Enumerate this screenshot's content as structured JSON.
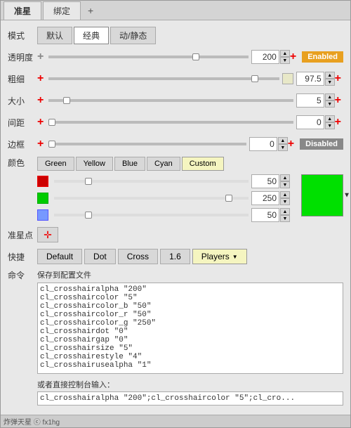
{
  "tabs": [
    {
      "label": "准星",
      "active": true
    },
    {
      "label": "绑定",
      "active": false
    },
    {
      "label": "+",
      "active": false
    }
  ],
  "sections": {
    "mode": {
      "label": "模式",
      "buttons": [
        "默认",
        "经典",
        "动/静态"
      ],
      "active": "经典"
    },
    "transparency": {
      "label": "透明度",
      "value": "200",
      "sliderPos": 75,
      "badge": "Enabled",
      "badgeType": "enabled"
    },
    "thickness": {
      "label": "粗细",
      "value": "97.5",
      "sliderPos": 90,
      "colorIndicator": "#e8e8c8"
    },
    "size": {
      "label": "大小",
      "value": "5",
      "sliderPos": 8
    },
    "gap": {
      "label": "间距",
      "value": "0",
      "sliderPos": 0
    },
    "border": {
      "label": "边框",
      "value": "0",
      "sliderPos": 0,
      "badge": "Disabled",
      "badgeType": "disabled"
    },
    "color": {
      "label": "颜色",
      "buttons": [
        "Green",
        "Yellow",
        "Blue",
        "Cyan",
        "Custom"
      ],
      "activeButton": "Custom",
      "sliders": [
        {
          "color": "#e00",
          "value": "50",
          "pos": 18
        },
        {
          "color": "#00cc00",
          "value": "250",
          "pos": 90
        },
        {
          "color": "#5588ff",
          "value": "50",
          "pos": 18
        }
      ],
      "previewColor": "#00e000"
    },
    "crosshairPoint": {
      "label": "准星点",
      "icon": "✛"
    },
    "shortcut": {
      "label": "快捷",
      "buttons": [
        "Default",
        "Dot",
        "Cross",
        "1.6",
        "Players"
      ]
    },
    "command": {
      "label": "命令",
      "saveLabel": "保存到配置文件",
      "lines": [
        "cl_crosshairalpha \"200\"",
        "cl_crosshaircolor \"5\"",
        "cl_crosshaircolor_b \"50\"",
        "cl_crosshaircolor_r \"50\"",
        "cl_crosshaircolor_g \"250\"",
        "cl_crosshairdot \"0\"",
        "cl_crosshairgap \"0\"",
        "cl_crosshairsize \"5\"",
        "cl_crosshairestyle \"4\"",
        "cl_crosshairusealpha \"1\""
      ],
      "directLabel": "或者直接控制台输入：",
      "directValue": "cl_crosshairalpha \"200\";cl_crosshaircolor \"5\";cl_cro..."
    }
  },
  "watermark": "炸弹天星 ⓒ fx1hg",
  "icons": {
    "plus": "+",
    "chevronDown": "▼",
    "spinUp": "▲",
    "spinDown": "▼"
  }
}
